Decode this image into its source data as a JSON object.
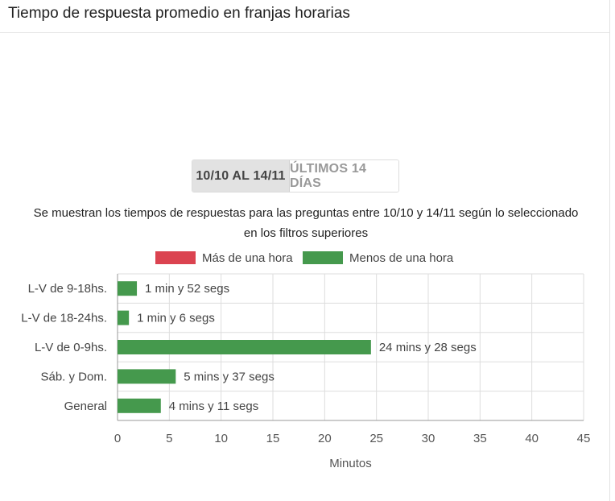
{
  "header": {
    "title": "Tiempo de respuesta promedio en franjas horarias"
  },
  "range_selector": {
    "options": [
      {
        "label": "10/10 AL 14/11",
        "active": true
      },
      {
        "label": "ÚLTIMOS 14 DÍAS",
        "active": false
      }
    ]
  },
  "caption": "Se muestran los tiempos de respuestas para las preguntas entre 10/10 y 14/11 según lo seleccionado en los filtros superiores",
  "colors": {
    "more_than_hour": "#db4350",
    "less_than_hour": "#45994d",
    "grid": "#dddddd",
    "axis": "#999999"
  },
  "chart_data": {
    "type": "bar",
    "orientation": "horizontal",
    "categories": [
      "L-V de 9-18hs.",
      "L-V de 18-24hs.",
      "L-V de 0-9hs.",
      "Sáb. y Dom.",
      "General"
    ],
    "series": [
      {
        "name": "Más de una hora",
        "color": "#db4350",
        "values": [
          0,
          0,
          0,
          0,
          0
        ]
      },
      {
        "name": "Menos de una hora",
        "color": "#45994d",
        "values": [
          1.87,
          1.1,
          24.47,
          5.62,
          4.18
        ]
      }
    ],
    "data_labels": [
      "1 min y 52 segs",
      "1 min y 6 segs",
      "24 mins y 28 segs",
      "5 mins y 37 segs",
      "4 mins y 11 segs"
    ],
    "xlabel": "Minutos",
    "xlim": [
      0,
      45
    ],
    "xticks": [
      0,
      5,
      10,
      15,
      20,
      25,
      30,
      35,
      40,
      45
    ],
    "grid": true,
    "legend": "top-center"
  }
}
